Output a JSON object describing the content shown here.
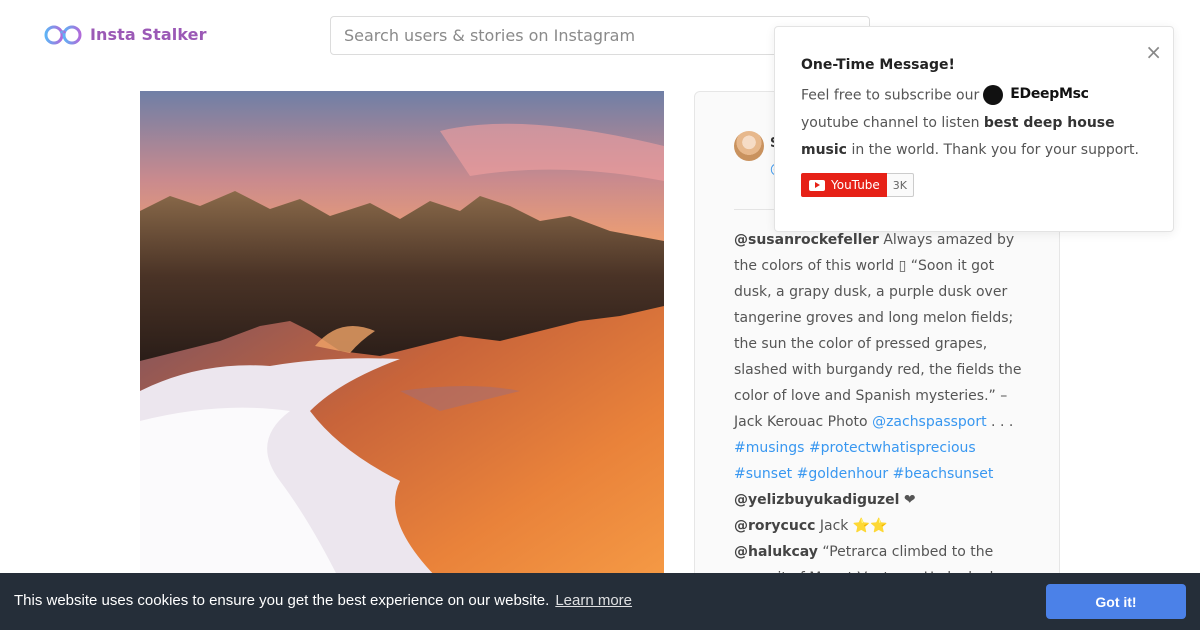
{
  "header": {
    "logo_text": "Insta Stalker",
    "search_placeholder": "Search users & stories on Instagram"
  },
  "post": {
    "username": "S",
    "handle": "@",
    "comments": [
      {
        "user": "@susanrockefeller",
        "text_before": " Always amazed by the colors of this world ▯ “Soon it got dusk, a grapy dusk, a purple dusk over tangerine groves and long melon fields; the sun the color of pressed grapes, slashed with burgandy red, the fields the color of love and Spanish mysteries.” – Jack Kerouac Photo ",
        "mention": "@zachspassport",
        "text_mid": " . . . ",
        "tags": [
          "#musings",
          "#protectwhatisprecious",
          "#sunset",
          "#goldenhour",
          "#beachsunset"
        ]
      },
      {
        "user": "@yelizbuyukadiguzel",
        "text": " ❤"
      },
      {
        "user": "@rorycucc",
        "text": " Jack ⭐⭐"
      },
      {
        "user": "@halukcay",
        "text": " “Petrarca climbed to the summit of Mount Ventoux. He looked"
      }
    ]
  },
  "popup": {
    "title": "One-Time Message!",
    "text_1": "Feel free to subscribe our",
    "channel_name": "EDeepMsc",
    "text_2": "youtube channel to listen",
    "bold": "best deep house music",
    "text_3": "in the world. Thank you for your support.",
    "youtube_label": "YouTube",
    "subscriber_count": "3K",
    "close_symbol": "×"
  },
  "cookie": {
    "message": "This website uses cookies to ensure you get the best experience on our website.",
    "learn_more": "Learn more",
    "accept": "Got it!"
  },
  "colors": {
    "brand": "#9b59b6",
    "link": "#3897f0",
    "cookie_bg": "#252e39",
    "cookie_button": "#4b81e8",
    "youtube_red": "#e62117"
  }
}
